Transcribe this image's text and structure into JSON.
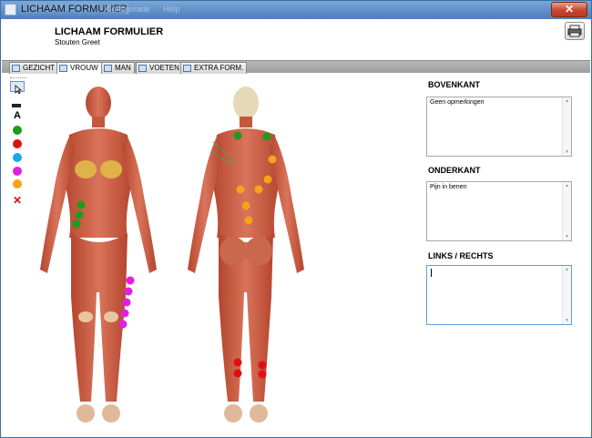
{
  "window": {
    "title": "LICHAAM FORMULIER",
    "ghost_menu": [
      "Configuratie",
      "Help"
    ],
    "close_label": "✕"
  },
  "header": {
    "title": "LICHAAM FORMULIER",
    "subtitle": "Stouten Greet"
  },
  "tabs": [
    {
      "label": "GEZICHT"
    },
    {
      "label": "VROUW"
    },
    {
      "label": "MAN"
    },
    {
      "label": "VOETEN"
    },
    {
      "label": "EXTRA FORM."
    }
  ],
  "toolbar": {
    "text_tool": "A",
    "delete_symbol": "✕",
    "colors": {
      "green": "#1e9a1e",
      "red": "#e01010",
      "blue": "#1aa8ec",
      "magenta": "#e31ee3",
      "orange": "#f7a21a"
    }
  },
  "panels": [
    {
      "heading": "BOVENKANT",
      "text": "Geen opmerkingen"
    },
    {
      "heading": "ONDERKANT",
      "text": "Pijn in benen"
    },
    {
      "heading": "LINKS / RECHTS",
      "text": ""
    }
  ]
}
